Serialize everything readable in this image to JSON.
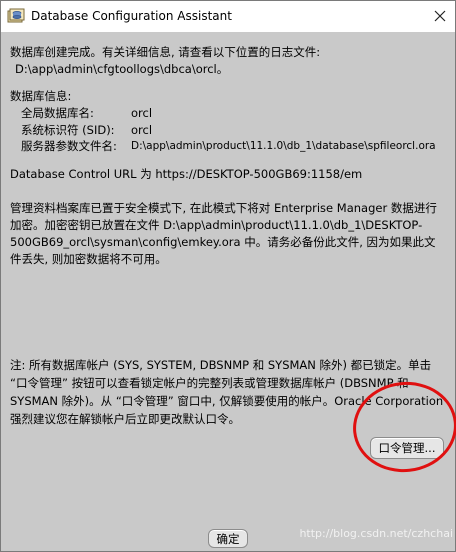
{
  "window": {
    "title": "Database Configuration Assistant",
    "icon": "database-app-icon",
    "close_icon": "close-icon"
  },
  "content": {
    "completion_msg": "数据库创建完成。有关详细信息, 请查看以下位置的日志文件:",
    "log_path": "D:\\app\\admin\\cfgtoollogs\\dbca\\orcl。",
    "db_info_heading": "数据库信息:",
    "db_info": [
      {
        "label": "全局数据库名:",
        "value": "orcl"
      },
      {
        "label": "系统标识符 (SID):",
        "value": "orcl"
      },
      {
        "label": "服务器参数文件名:",
        "value": "D:\\app\\admin\\product\\11.1.0\\db_1\\database\\spfileorcl.ora"
      }
    ],
    "control_url": "Database Control URL 为 https://DESKTOP-500GB69:1158/em",
    "security_para": "管理资料档案库已置于安全模式下, 在此模式下将对 Enterprise Manager 数据进行加密。加密密钥已放置在文件 D:\\app\\admin\\product\\11.1.0\\db_1\\DESKTOP-500GB69_orcl\\sysman\\config\\emkey.ora 中。请务必备份此文件, 因为如果此文件丢失, 则加密数据将不可用。",
    "note_para": "注: 所有数据库帐户 (SYS, SYSTEM, DBSNMP 和 SYSMAN 除外) 都已锁定。单击 “口令管理” 按钮可以查看锁定帐户的完整列表或管理数据库帐户 (DBSNMP 和 SYSMAN 除外)。从 “口令管理” 窗口中, 仅解锁要使用的帐户。Oracle Corporation 强烈建议您在解锁帐户后立即更改默认口令。"
  },
  "buttons": {
    "password_mgmt": "口令管理...",
    "ok": "确定"
  },
  "annotation": {
    "circle_color": "#e01010"
  },
  "watermark": "http://blog.csdn.net/czhchai"
}
